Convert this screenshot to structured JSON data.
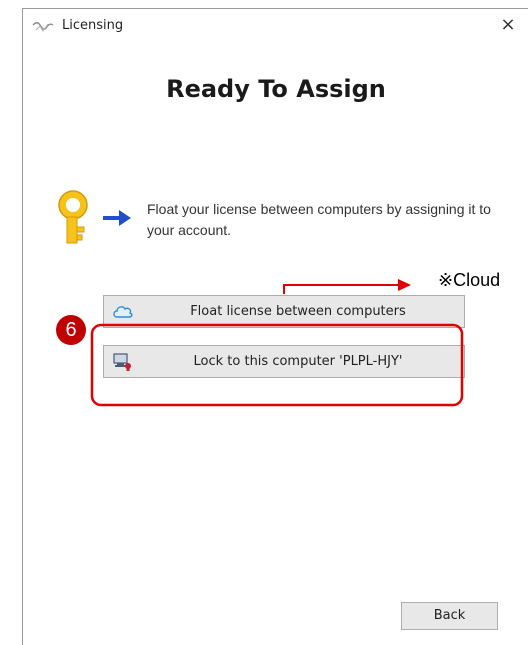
{
  "window": {
    "title": "Licensing",
    "close_glyph": "×"
  },
  "content": {
    "heading": "Ready To Assign",
    "description": "Float your license between computers by assigning it to your account."
  },
  "buttons": {
    "float_label": "Float license between computers",
    "lock_label": "Lock to this computer 'PLPL-HJY'",
    "back_label": "Back"
  },
  "icons": {
    "title": "licensing-logo-icon",
    "key": "key-arrow-icon",
    "float": "cloud-icon",
    "lock": "computer-lock-icon"
  },
  "annotation": {
    "note": "※Cloud",
    "step_number": "6",
    "highlight_color": "#e00000"
  }
}
